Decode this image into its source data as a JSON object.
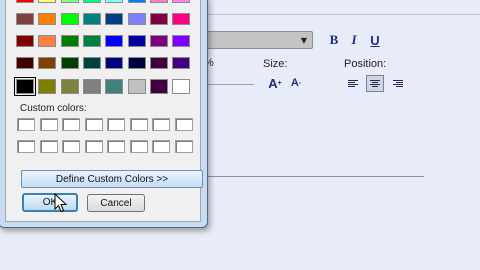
{
  "background": {
    "toolbar": {
      "bold_label": "B",
      "italic_label": "I",
      "underline_label": "U",
      "percent_label": "%",
      "size_label": "Size:",
      "position_label": "Position:",
      "grow_label": "A",
      "shrink_label": "A",
      "grow_sup": "+",
      "shrink_sup": "-",
      "alignment_selected": "center"
    }
  },
  "dialog": {
    "basic_colors": [
      [
        "#ff0000",
        "#ffff80",
        "#80ff80",
        "#00ff80",
        "#80ffff",
        "#0080ff",
        "#ff80c0",
        "#ff80ff"
      ],
      [
        "#804040",
        "#ff8000",
        "#00ff00",
        "#008080",
        "#004080",
        "#8080ff",
        "#800040",
        "#ff0080"
      ],
      [
        "#800000",
        "#ff8040",
        "#008000",
        "#008040",
        "#0000ff",
        "#0000a0",
        "#800080",
        "#8000ff"
      ],
      [
        "#400000",
        "#804000",
        "#004000",
        "#004040",
        "#000080",
        "#000040",
        "#400040",
        "#400080"
      ],
      [
        "#000000",
        "#808000",
        "#808040",
        "#808080",
        "#408080",
        "#c0c0c0",
        "#400040",
        "#ffffff"
      ]
    ],
    "selected_color": "#000000",
    "custom_colors_label": "Custom colors:",
    "custom_colors": [
      [
        "#ffffff",
        "#ffffff",
        "#ffffff",
        "#ffffff",
        "#ffffff",
        "#ffffff",
        "#ffffff",
        "#ffffff"
      ],
      [
        "#ffffff",
        "#ffffff",
        "#ffffff",
        "#ffffff",
        "#ffffff",
        "#ffffff",
        "#ffffff",
        "#ffffff"
      ]
    ],
    "define_button_label": "Define Custom Colors >>",
    "ok_label": "OK",
    "cancel_label": "Cancel"
  }
}
